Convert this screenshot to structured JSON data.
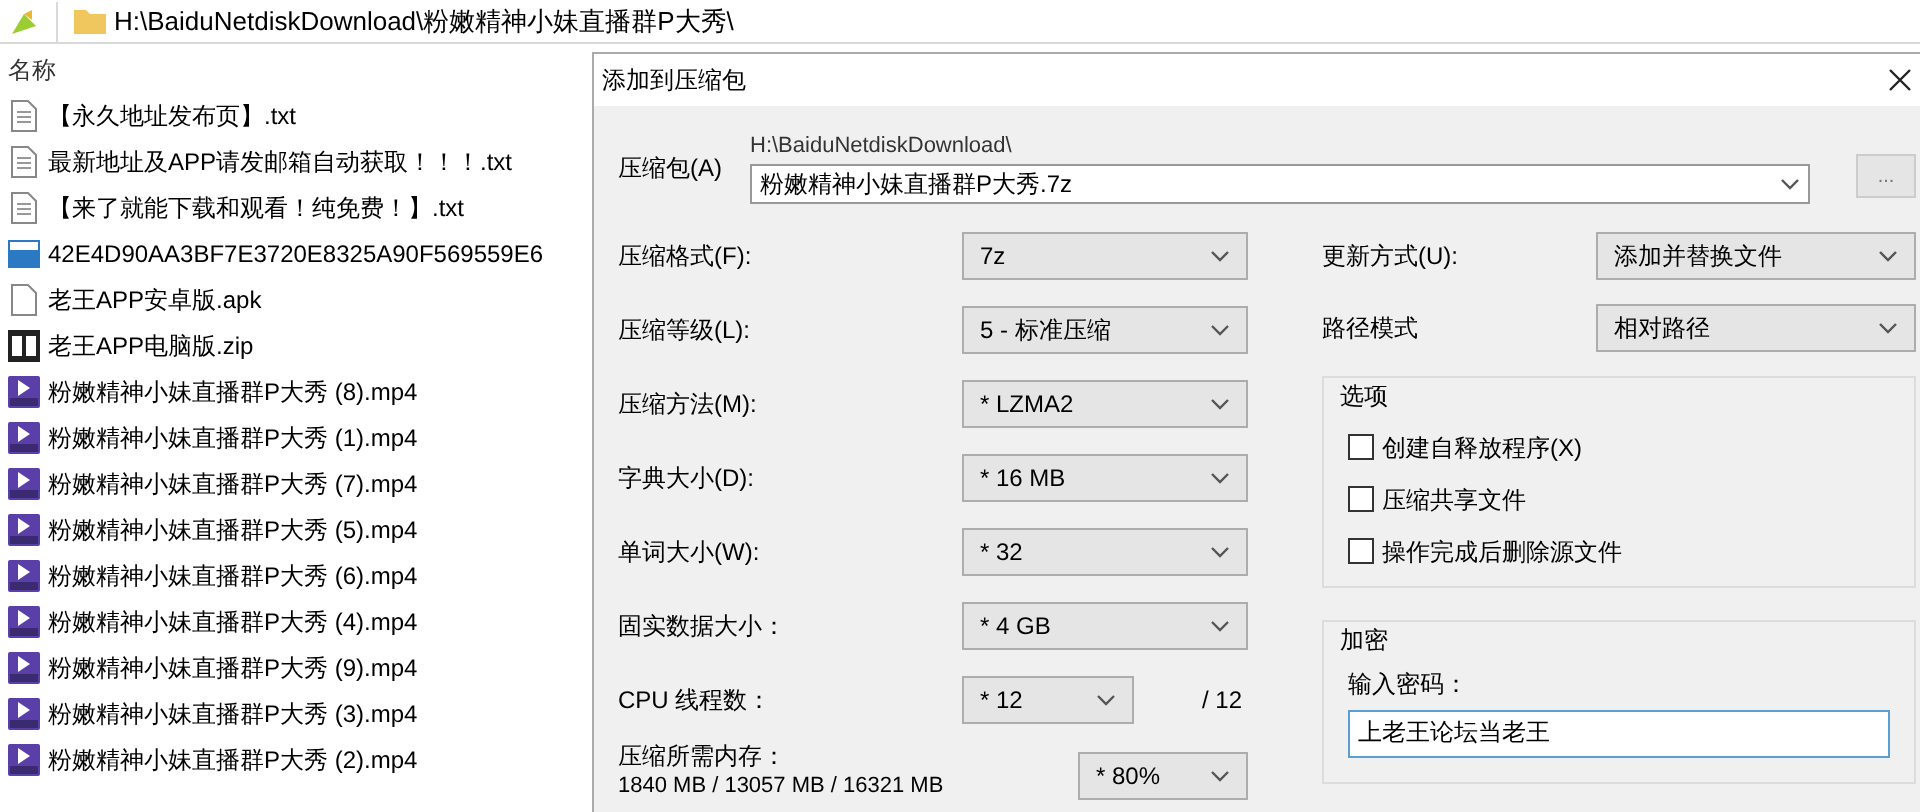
{
  "address_bar": {
    "path": "H:\\BaiduNetdiskDownload\\粉嫩精神小妹直播群P大秀\\"
  },
  "file_list": {
    "column_header": "名称",
    "files": [
      {
        "name": "【永久地址发布页】.txt",
        "kind": "text"
      },
      {
        "name": "最新地址及APP请发邮箱自动获取！！！.txt",
        "kind": "text"
      },
      {
        "name": "【来了就能下载和观看！纯免费！】.txt",
        "kind": "text"
      },
      {
        "name": "42E4D90AA3BF7E3720E8325A90F569559E6",
        "kind": "blue"
      },
      {
        "name": "老王APP安卓版.apk",
        "kind": "blank"
      },
      {
        "name": "老王APP电脑版.zip",
        "kind": "archive"
      },
      {
        "name": "粉嫩精神小妹直播群P大秀 (8).mp4",
        "kind": "video"
      },
      {
        "name": "粉嫩精神小妹直播群P大秀 (1).mp4",
        "kind": "video"
      },
      {
        "name": "粉嫩精神小妹直播群P大秀 (7).mp4",
        "kind": "video"
      },
      {
        "name": "粉嫩精神小妹直播群P大秀 (5).mp4",
        "kind": "video"
      },
      {
        "name": "粉嫩精神小妹直播群P大秀 (6).mp4",
        "kind": "video"
      },
      {
        "name": "粉嫩精神小妹直播群P大秀 (4).mp4",
        "kind": "video"
      },
      {
        "name": "粉嫩精神小妹直播群P大秀 (9).mp4",
        "kind": "video"
      },
      {
        "name": "粉嫩精神小妹直播群P大秀 (3).mp4",
        "kind": "video"
      },
      {
        "name": "粉嫩精神小妹直播群P大秀 (2).mp4",
        "kind": "video"
      }
    ]
  },
  "dialog": {
    "title": "添加到压缩包",
    "archive": {
      "label": "压缩包(A)",
      "folder": "H:\\BaiduNetdiskDownload\\",
      "value": "粉嫩精神小妹直播群P大秀.7z",
      "browse": "..."
    },
    "settings": [
      {
        "label": "压缩格式(F):",
        "value": "7z"
      },
      {
        "label": "压缩等级(L):",
        "value": "5 - 标准压缩"
      },
      {
        "label": "压缩方法(M):",
        "value": "* LZMA2"
      },
      {
        "label": "字典大小(D):",
        "value": "* 16 MB"
      },
      {
        "label": "单词大小(W):",
        "value": "* 32"
      },
      {
        "label": "固实数据大小：",
        "value": "* 4 GB"
      }
    ],
    "cpu": {
      "label": "CPU 线程数：",
      "value": "* 12",
      "total": "/ 12"
    },
    "memory": {
      "label": "压缩所需内存：",
      "usage": "1840 MB / 13057 MB / 16321 MB",
      "value": "* 80%"
    },
    "update_mode": {
      "label": "更新方式(U):",
      "value": "添加并替换文件"
    },
    "path_mode": {
      "label": "路径模式",
      "value": "相对路径"
    },
    "options": {
      "title": "选项",
      "items": [
        {
          "label": "创建自释放程序(X)",
          "checked": false
        },
        {
          "label": "压缩共享文件",
          "checked": false
        },
        {
          "label": "操作完成后删除源文件",
          "checked": false
        }
      ]
    },
    "encryption": {
      "title": "加密",
      "password_label": "输入密码：",
      "password": "上老王论坛当老王"
    }
  }
}
